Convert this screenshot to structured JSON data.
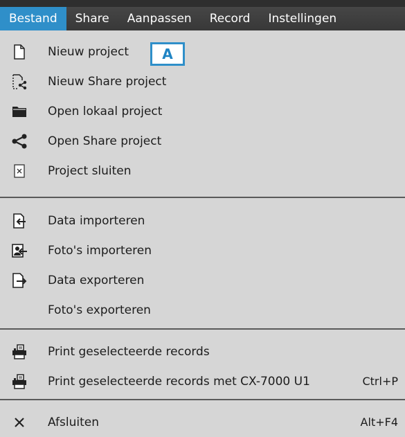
{
  "menubar": {
    "tabs": [
      {
        "label": "Bestand",
        "active": true
      },
      {
        "label": "Share"
      },
      {
        "label": "Aanpassen"
      },
      {
        "label": "Record"
      },
      {
        "label": "Instellingen"
      }
    ]
  },
  "menu": {
    "items": [
      {
        "label": "Nieuw project",
        "icon": "new-document-icon"
      },
      {
        "label": "Nieuw Share project",
        "icon": "new-share-icon"
      },
      {
        "label": "Open lokaal project",
        "icon": "folder-icon"
      },
      {
        "label": "Open Share project",
        "icon": "share-icon"
      },
      {
        "label": "Project sluiten",
        "icon": "close-document-icon"
      },
      {
        "label": "Data importeren",
        "icon": "import-icon"
      },
      {
        "label": "Foto's importeren",
        "icon": "photo-import-icon"
      },
      {
        "label": "Data exporteren",
        "icon": "export-icon"
      },
      {
        "label": "Foto's exporteren",
        "icon": ""
      },
      {
        "label": "Print geselecteerde records",
        "icon": "printer-icon"
      },
      {
        "label": "Print geselecteerde records met CX-7000 U1",
        "icon": "printer-icon",
        "shortcut": "Ctrl+P"
      },
      {
        "label": "Afsluiten",
        "icon": "close-icon",
        "shortcut": "Alt+F4"
      }
    ]
  },
  "callout": {
    "label": "A"
  },
  "colors": {
    "menubar": "#3e3e3e",
    "active_tab": "#2f8fc9",
    "panel": "#d6d6d6",
    "separator": "#5a5a5a"
  }
}
